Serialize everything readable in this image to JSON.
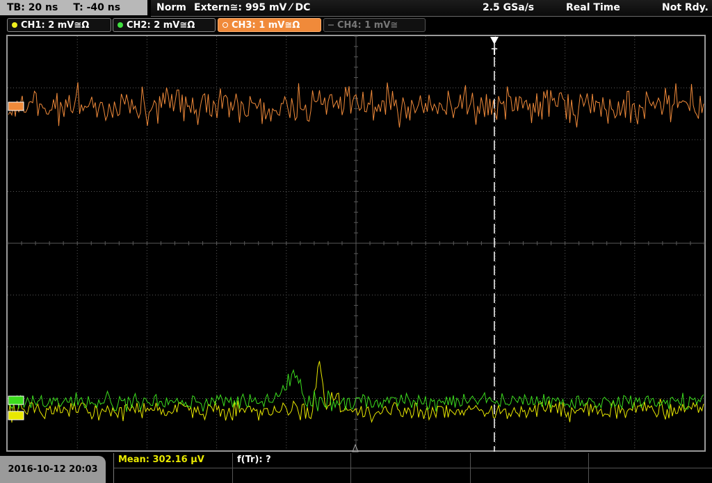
{
  "topbar": {
    "tb": "TB: 20 ns",
    "t": "T: -40 ns",
    "mode": "Norm",
    "trigger": "Extern≅: 995 mV ⁄ DC",
    "rate": "2.5 GSa/s",
    "acq": "Real Time",
    "status": "Not Rdy."
  },
  "channels": [
    {
      "label": "CH1: 2 mV≅Ω",
      "color": "#f0f020"
    },
    {
      "label": "CH2: 2 mV≅Ω",
      "color": "#40e040"
    },
    {
      "label": "CH3: 1 mV≅Ω",
      "color": "#ffffff"
    },
    {
      "label": "CH4: 1 mV≅",
      "color": "#555555"
    }
  ],
  "colors": {
    "ch1": "#e8e800",
    "ch2": "#3cdc1e",
    "ch3": "#f08a3a",
    "grid": "#5a5a5a"
  },
  "markers": {
    "trigger": "T"
  },
  "footer": {
    "datetime": "2016-10-12 20:03",
    "mean": "Mean: 302.16 µV",
    "ftr": "f(Tr): ?"
  }
}
